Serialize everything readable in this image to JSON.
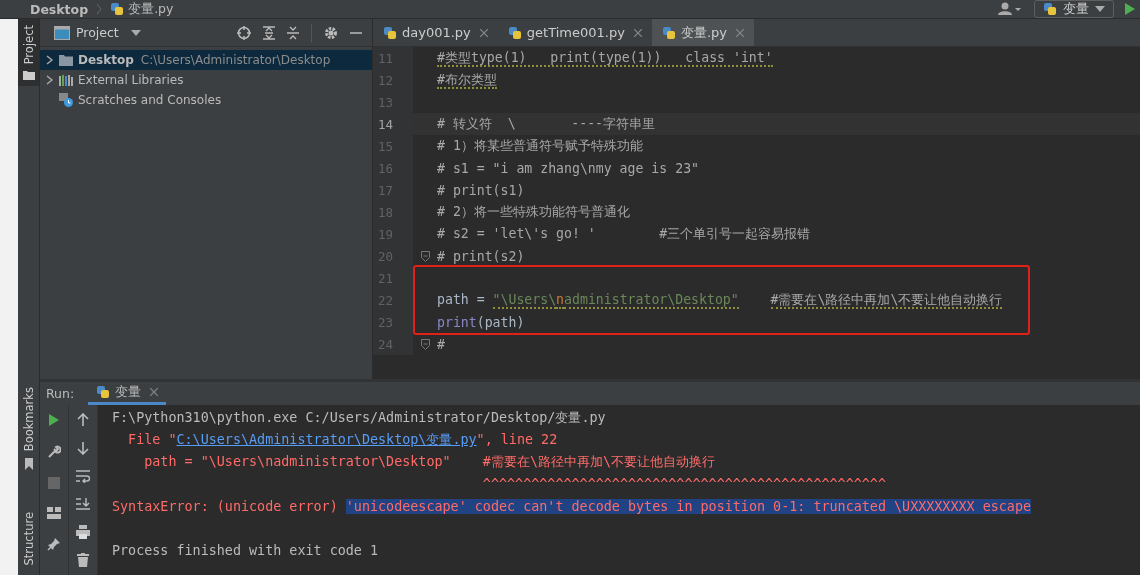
{
  "breadcrumb": {
    "folder": "Desktop",
    "file": "变量.py"
  },
  "run_config": {
    "label": "变量"
  },
  "tool_strip": {
    "top": [
      {
        "label": "Project",
        "selected": true
      }
    ],
    "bottom": [
      {
        "label": "Bookmarks",
        "selected": false
      },
      {
        "label": "Structure",
        "selected": false
      }
    ]
  },
  "project": {
    "title": "Project",
    "tree": [
      {
        "label": "Desktop",
        "path": "C:\\Users\\Administrator\\Desktop",
        "kind": "folder",
        "expandable": true,
        "selected": true
      },
      {
        "label": "External Libraries",
        "kind": "library",
        "expandable": true,
        "selected": false
      },
      {
        "label": "Scratches and Consoles",
        "kind": "scratch",
        "expandable": false,
        "selected": false
      }
    ]
  },
  "editor": {
    "tabs": [
      {
        "label": "day001.py",
        "selected": false
      },
      {
        "label": "getTime001.py",
        "selected": false
      },
      {
        "label": "变量.py",
        "selected": true
      }
    ],
    "lines": [
      {
        "number": "11",
        "current": false,
        "fold": false,
        "boxed": false,
        "tokens": [
          {
            "text": "#类型type(1)   print(type(1))   class 'int'",
            "kind": "comment",
            "warning": true
          }
        ]
      },
      {
        "number": "12",
        "current": false,
        "fold": false,
        "boxed": false,
        "tokens": [
          {
            "text": "#布尔类型",
            "kind": "comment",
            "warning": true
          }
        ]
      },
      {
        "number": "13",
        "current": false,
        "fold": false,
        "boxed": false
      },
      {
        "number": "14",
        "current": true,
        "fold": false,
        "boxed": false,
        "tokens": [
          {
            "text": "# 转义符  \\       ----字符串里",
            "kind": "comment",
            "warning": false
          }
        ]
      },
      {
        "number": "15",
        "current": false,
        "fold": false,
        "boxed": false,
        "tokens": [
          {
            "text": "# 1）将某些普通符号赋予特殊功能",
            "kind": "comment",
            "warning": false
          }
        ]
      },
      {
        "number": "16",
        "current": false,
        "fold": false,
        "boxed": false,
        "tokens": [
          {
            "text": "# s1 = \"i am zhang\\nmy age is 23\"",
            "kind": "comment",
            "warning": false
          }
        ]
      },
      {
        "number": "17",
        "current": false,
        "fold": false,
        "boxed": false,
        "tokens": [
          {
            "text": "# print(s1)",
            "kind": "comment",
            "warning": false
          }
        ]
      },
      {
        "number": "18",
        "current": false,
        "fold": false,
        "boxed": false,
        "tokens": [
          {
            "text": "# 2）将一些特殊功能符号普通化",
            "kind": "comment",
            "warning": false
          }
        ]
      },
      {
        "number": "19",
        "current": false,
        "fold": false,
        "boxed": false,
        "tokens": [
          {
            "text": "# s2 = 'let\\'s go! '        #三个单引号一起容易报错",
            "kind": "comment",
            "warning": false
          }
        ]
      },
      {
        "number": "20",
        "current": false,
        "fold": true,
        "boxed": false,
        "tokens": [
          {
            "text": "# print(s2)",
            "kind": "comment",
            "warning": false
          }
        ]
      },
      {
        "number": "21",
        "current": false,
        "fold": false,
        "boxed": true
      },
      {
        "number": "22",
        "current": false,
        "fold": false,
        "boxed": true,
        "tokens": [
          {
            "text": "path = ",
            "kind": "plain",
            "warning": false
          },
          {
            "text": "\"\\Users\\",
            "kind": "string",
            "warning": true
          },
          {
            "text": "n",
            "kind": "escape",
            "warning": true
          },
          {
            "text": "administrator\\Desktop\"",
            "kind": "string",
            "warning": true
          },
          {
            "text": "    #需要在\\路径中再加\\不要让他自动换行",
            "kind": "comment",
            "warning": true
          }
        ]
      },
      {
        "number": "23",
        "current": false,
        "fold": false,
        "boxed": true,
        "tokens": [
          {
            "text": "print",
            "kind": "builtin",
            "warning": false
          },
          {
            "text": "(path)",
            "kind": "plain",
            "warning": false
          }
        ]
      },
      {
        "number": "24",
        "current": false,
        "fold": true,
        "boxed": false,
        "tokens": [
          {
            "text": "#",
            "kind": "comment",
            "warning": false
          }
        ]
      }
    ]
  },
  "run": {
    "title": "Run:",
    "tabs": [
      {
        "label": "变量",
        "selected": true
      }
    ],
    "console": [
      {
        "kind": "output",
        "tokens": [
          {
            "text": "F:\\Python310\\python.exe C:/Users/Administrator/Desktop/变量.py",
            "kind": "plain"
          }
        ]
      },
      {
        "kind": "output",
        "tokens": [
          {
            "text": "  File \"",
            "kind": "error"
          },
          {
            "text": "C:\\Users\\Administrator\\Desktop\\变量.py",
            "kind": "link"
          },
          {
            "text": "\", line 22",
            "kind": "error"
          }
        ]
      },
      {
        "kind": "output",
        "tokens": [
          {
            "text": "    path = \"\\Users\\nadministrator\\Desktop\"    #需要在\\路径中再加\\不要让他自动换行",
            "kind": "error"
          }
        ]
      },
      {
        "kind": "output",
        "tokens": [
          {
            "text": "                                              ^^^^^^^^^^^^^^^^^^^^^^^^^^^^^^^^^^^^^^^^^^^^^^^^^^",
            "kind": "error"
          }
        ]
      },
      {
        "kind": "output",
        "tokens": [
          {
            "text": "SyntaxError: (unicode error) ",
            "kind": "error"
          },
          {
            "text": "'unicodeescape' codec can't decode bytes in position 0-1: truncated \\UXXXXXXXX escape",
            "kind": "selected-error"
          }
        ]
      },
      {
        "kind": "exit",
        "tokens": [
          {
            "text": "Process finished with exit code 1",
            "kind": "plain"
          }
        ]
      }
    ]
  }
}
